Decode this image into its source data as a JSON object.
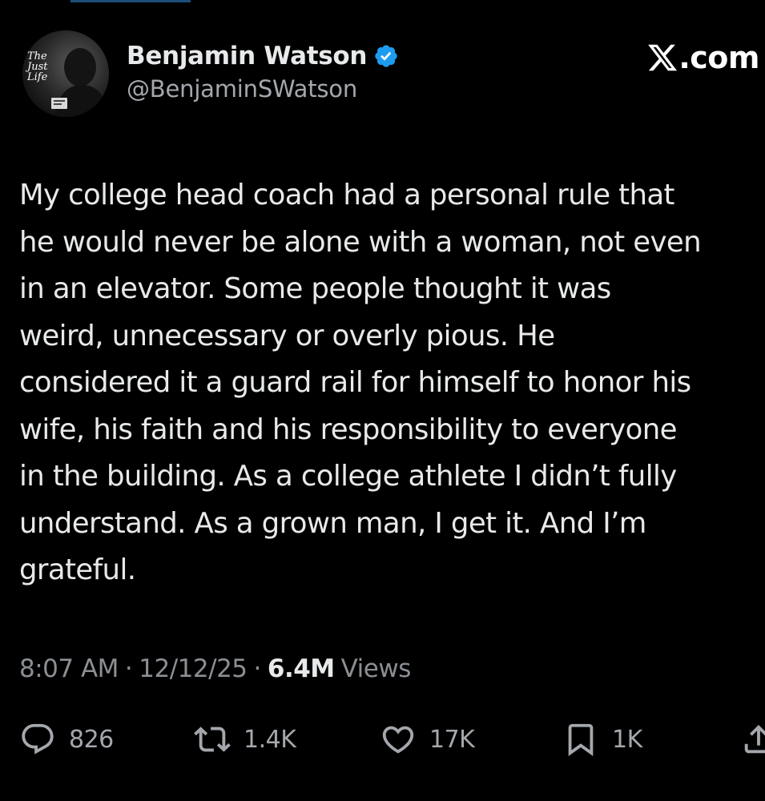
{
  "author": {
    "display_name": "Benjamin Watson",
    "handle": "@BenjaminSWatson",
    "avatar_text": "The Just Life",
    "verified_icon": "verified-badge-icon"
  },
  "brand": {
    "text": ".com",
    "icon": "x-logo-icon"
  },
  "tweet": {
    "lines": [
      "My college head coach had a personal rule that",
      "he would never be alone with a woman, not even",
      "in an elevator. Some people thought it was",
      "weird, unnecessary or overly pious. He",
      "considered it a guard rail for himself to honor his",
      "wife, his faith and his responsibility to everyone",
      "in the building. As a college athlete I didn’t fully",
      "understand. As a grown man, I get it. And I’m",
      "grateful."
    ]
  },
  "meta": {
    "time": "8:07 AM",
    "separator": "·",
    "date": "12/12/25",
    "views_count": "6.4M",
    "views_label": "Views"
  },
  "actions": {
    "reply": {
      "icon": "reply-icon",
      "count": "826"
    },
    "repost": {
      "icon": "repost-icon",
      "count": "1.4K"
    },
    "like": {
      "icon": "heart-icon",
      "count": "17K"
    },
    "bookmark": {
      "icon": "bookmark-icon",
      "count": "1K"
    },
    "share": {
      "icon": "share-icon"
    }
  },
  "colors": {
    "background": "#000000",
    "primary_text": "#e7e9ea",
    "secondary_text": "#8b8f94",
    "verified_blue": "#1d9bf0"
  }
}
